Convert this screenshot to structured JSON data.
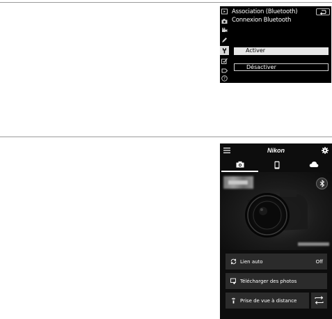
{
  "camera_menu": {
    "title": "Association (Bluetooth)",
    "subtitle": "Connexion Bluetooth",
    "options": [
      {
        "label": "Activer",
        "selected": true
      },
      {
        "label": "Désactiver",
        "selected": false
      }
    ],
    "sidebar_icons": [
      "playback-icon",
      "camera-icon",
      "movie-icon",
      "pencil-icon",
      "wrench-icon",
      "retouch-icon",
      "my-menu-icon",
      "help-icon"
    ],
    "active_sidebar_icon": "wrench-icon",
    "colors": {
      "selected_bg": "#e6e6e6",
      "screen_bg": "#000000"
    }
  },
  "phone_app": {
    "logo": "Nikon",
    "tabs": [
      {
        "icon": "camera-icon",
        "active": true
      },
      {
        "icon": "smartphone-icon",
        "active": false
      },
      {
        "icon": "cloud-icon",
        "active": false
      }
    ],
    "cards": {
      "auto_link": {
        "label": "Lien auto",
        "value": "Off"
      },
      "download": {
        "label": "Télécharger des photos"
      },
      "remote": {
        "label": "Prise de vue à distance"
      }
    },
    "colors": {
      "card_bg": "#2b2b2b",
      "screen_bg": "#0d0d0d"
    }
  }
}
